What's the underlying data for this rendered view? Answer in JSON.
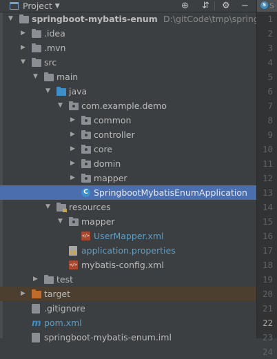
{
  "panel": {
    "title": "Project",
    "tools": [
      "crosshair-icon",
      "collapse-icon",
      "gear-icon",
      "minimize-icon"
    ]
  },
  "tree": [
    {
      "depth": 0,
      "arrow": "open",
      "icon": "folder",
      "name": "project-root",
      "label": "springboot-mybatis-enum",
      "bold": true,
      "suffix": "D:\\gitCode\\tmp\\springboot"
    },
    {
      "depth": 1,
      "arrow": "closed",
      "icon": "folder",
      "name": "idea",
      "label": ".idea"
    },
    {
      "depth": 1,
      "arrow": "closed",
      "icon": "folder",
      "name": "mvn",
      "label": ".mvn"
    },
    {
      "depth": 1,
      "arrow": "open",
      "icon": "folder",
      "name": "src",
      "label": "src"
    },
    {
      "depth": 2,
      "arrow": "open",
      "icon": "folder",
      "name": "main",
      "label": "main"
    },
    {
      "depth": 3,
      "arrow": "open",
      "icon": "folder-blue",
      "name": "java",
      "label": "java"
    },
    {
      "depth": 4,
      "arrow": "open",
      "icon": "package",
      "name": "com-example-demo",
      "label": "com.example.demo"
    },
    {
      "depth": 5,
      "arrow": "closed",
      "icon": "package",
      "name": "common",
      "label": "common"
    },
    {
      "depth": 5,
      "arrow": "closed",
      "icon": "package",
      "name": "controller",
      "label": "controller"
    },
    {
      "depth": 5,
      "arrow": "closed",
      "icon": "package",
      "name": "core",
      "label": "core"
    },
    {
      "depth": 5,
      "arrow": "closed",
      "icon": "package",
      "name": "domin",
      "label": "domin"
    },
    {
      "depth": 5,
      "arrow": "closed",
      "icon": "package",
      "name": "mapper",
      "label": "mapper"
    },
    {
      "depth": 5,
      "arrow": "none",
      "icon": "class",
      "name": "application-class",
      "label": "SpringbootMybatisEnumApplication",
      "selected": true
    },
    {
      "depth": 3,
      "arrow": "open",
      "icon": "folder-res",
      "name": "resources",
      "label": "resources"
    },
    {
      "depth": 4,
      "arrow": "open",
      "icon": "package",
      "name": "mapper-res",
      "label": "mapper"
    },
    {
      "depth": 5,
      "arrow": "none",
      "icon": "xml",
      "name": "usermapper-xml",
      "label": "UserMapper.xml",
      "color": "blue"
    },
    {
      "depth": 4,
      "arrow": "none",
      "icon": "properties",
      "name": "application-properties",
      "label": "application.properties",
      "color": "blue"
    },
    {
      "depth": 4,
      "arrow": "none",
      "icon": "xml",
      "name": "mybatis-config",
      "label": "mybatis-config.xml"
    },
    {
      "depth": 2,
      "arrow": "closed",
      "icon": "folder",
      "name": "test",
      "label": "test"
    },
    {
      "depth": 1,
      "arrow": "closed",
      "icon": "folder-orange",
      "name": "target",
      "label": "target",
      "excluded": true
    },
    {
      "depth": 1,
      "arrow": "none",
      "icon": "git",
      "name": "gitignore",
      "label": ".gitignore"
    },
    {
      "depth": 1,
      "arrow": "none",
      "icon": "maven",
      "name": "pom",
      "label": "pom.xml",
      "color": "blue"
    },
    {
      "depth": 1,
      "arrow": "none",
      "icon": "file",
      "name": "iml",
      "label": "springboot-mybatis-enum.iml"
    }
  ],
  "editor": {
    "tab_letter": "S",
    "tab_text": "S",
    "lines": [
      "1",
      "2",
      "3",
      "4",
      "5",
      "6",
      "7",
      "8",
      "9",
      "10",
      "11",
      "12",
      "13",
      "14",
      "15",
      "16",
      "17",
      "18",
      "19",
      "20",
      "21",
      "22",
      "23",
      "24"
    ],
    "current_line": "22"
  },
  "colors": {
    "selection": "#4b6eaf",
    "panel_bg": "#3c3f41",
    "gutter_bg": "#313335",
    "excluded_bg": "#4c3f2f"
  }
}
